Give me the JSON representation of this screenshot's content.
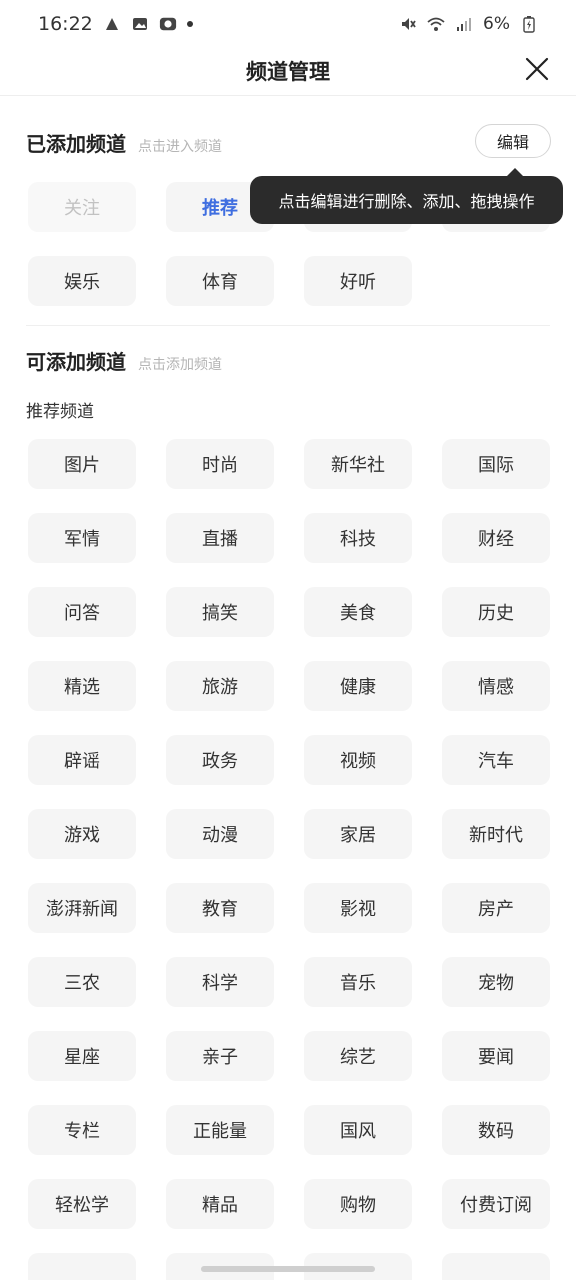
{
  "status_bar": {
    "time": "16:22",
    "battery": "6%"
  },
  "header": {
    "title": "频道管理"
  },
  "added": {
    "title": "已添加频道",
    "hint": "点击进入频道",
    "edit_label": "编辑",
    "tooltip": "点击编辑进行删除、添加、拖拽操作",
    "items": [
      "关注",
      "推荐",
      "",
      "",
      "娱乐",
      "体育",
      "好听"
    ]
  },
  "available": {
    "title": "可添加频道",
    "hint": "点击添加频道",
    "sub_title": "推荐频道",
    "items": [
      "图片",
      "时尚",
      "新华社",
      "国际",
      "军情",
      "直播",
      "科技",
      "财经",
      "问答",
      "搞笑",
      "美食",
      "历史",
      "精选",
      "旅游",
      "健康",
      "情感",
      "辟谣",
      "政务",
      "视频",
      "汽车",
      "游戏",
      "动漫",
      "家居",
      "新时代",
      "澎湃新闻",
      "教育",
      "影视",
      "房产",
      "三农",
      "科学",
      "音乐",
      "宠物",
      "星座",
      "亲子",
      "综艺",
      "要闻",
      "专栏",
      "正能量",
      "国风",
      "数码",
      "轻松学",
      "精品",
      "购物",
      "付费订阅",
      "",
      "",
      "",
      ""
    ]
  },
  "colors": {
    "accent": "#3f6ee0",
    "chip_bg": "#f5f5f5",
    "tooltip_bg": "#2b2b2b"
  }
}
